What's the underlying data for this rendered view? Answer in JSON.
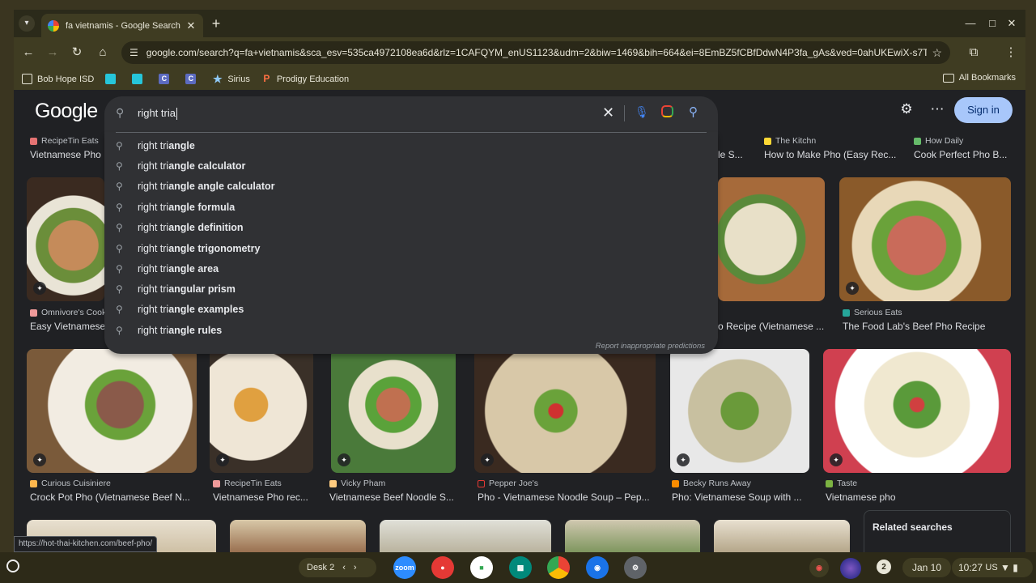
{
  "browser": {
    "tab_title": "fa vietnamis - Google Search",
    "url": "google.com/search?q=fa+vietnamis&sca_esv=535ca4972108ea6d&rlz=1CAFQYM_enUS1123&udm=2&biw=1469&bih=664&ei=8EmBZ5fCBfDdwN4P3fa_gAs&ved=0ahUKEwiX-s7Ty...",
    "bookmarks": [
      "Bob Hope ISD",
      "Sirius",
      "Prodigy Education"
    ],
    "all_bookmarks": "All Bookmarks",
    "status_url": "https://hot-thai-kitchen.com/beef-pho/"
  },
  "google": {
    "logo": "Google",
    "query": "right tria",
    "sign_in": "Sign in",
    "report": "Report inappropriate predictions",
    "suggestions": [
      {
        "prefix": "right tri",
        "rest": "angle"
      },
      {
        "prefix": "right tri",
        "rest": "angle calculator"
      },
      {
        "prefix": "right tri",
        "rest": "angle angle calculator"
      },
      {
        "prefix": "right tri",
        "rest": "angle formula"
      },
      {
        "prefix": "right tri",
        "rest": "angle definition"
      },
      {
        "prefix": "right tri",
        "rest": "angle trigonometry"
      },
      {
        "prefix": "right tri",
        "rest": "angle area"
      },
      {
        "prefix": "right tri",
        "rest": "angular prism"
      },
      {
        "prefix": "right tri",
        "rest": "angle examples"
      },
      {
        "prefix": "right tri",
        "rest": "angle rules"
      }
    ],
    "top_results": [
      {
        "source": "RecipeTin Eats",
        "caption": "Vietnamese Pho"
      },
      {
        "source": "The Kitchn",
        "caption": "How to Make Pho (Easy Rec..."
      },
      {
        "source": "How Daily",
        "caption": "Cook Perfect Pho B..."
      },
      {
        "caption": "le S..."
      }
    ],
    "row1": [
      {
        "source": "Omnivore's Cook",
        "caption": "Easy Vietnamese"
      },
      {
        "caption": "o Recipe (Vietnamese ..."
      },
      {
        "source": "Serious Eats",
        "caption": "The Food Lab's Beef Pho Recipe"
      }
    ],
    "row2": [
      {
        "source": "Curious Cuisiniere",
        "caption": "Crock Pot Pho (Vietnamese Beef N..."
      },
      {
        "source": "RecipeTin Eats",
        "caption": "Vietnamese Pho rec..."
      },
      {
        "source": "Vicky Pham",
        "caption": "Vietnamese Beef Noodle S..."
      },
      {
        "source": "Pepper Joe's",
        "caption": "Pho - Vietnamese Noodle Soup – Pep..."
      },
      {
        "source": "Becky Runs Away",
        "caption": "Pho: Vietnamese Soup with ..."
      },
      {
        "source": "Taste",
        "caption": "Vietnamese pho"
      }
    ],
    "related_searches": "Related searches"
  },
  "shelf": {
    "desk": "Desk 2",
    "notifications": "2",
    "date": "Jan 10",
    "time": "10:27",
    "locale": "US",
    "zoom_label": "zoom"
  }
}
